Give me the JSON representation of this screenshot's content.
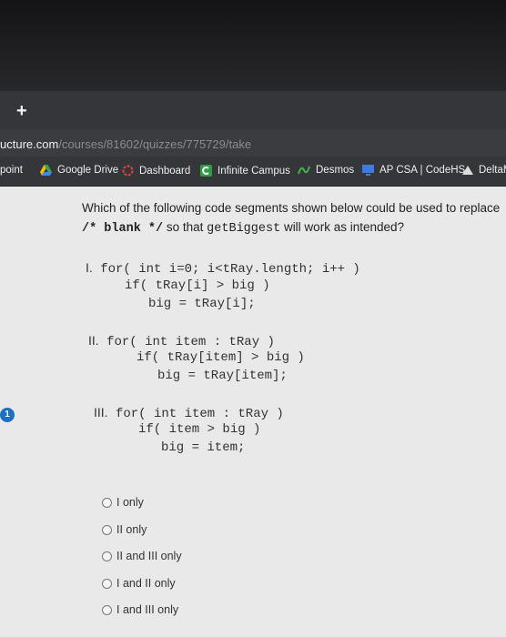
{
  "browser": {
    "url_host": "ucture.com",
    "url_path": "/courses/81602/quizzes/775729/take",
    "new_tab": "+"
  },
  "bookmarks": [
    {
      "label": "point"
    },
    {
      "label": "Google Drive"
    },
    {
      "label": "Dashboard"
    },
    {
      "label": "Infinite Campus"
    },
    {
      "label": "Desmos"
    },
    {
      "label": "AP CSA | CodeHS"
    },
    {
      "label": "DeltaM"
    }
  ],
  "quiz": {
    "badge": "1",
    "question_line1": "Which of the following code segments shown below could be used to replace",
    "question_code": "/* blank */",
    "question_tail_pre": "so that ",
    "question_method": "getBiggest",
    "question_tail_post": " will work as intended?",
    "segments": [
      {
        "numeral": "I.",
        "lines": [
          "for( int i=0; i<tRay.length; i++ )",
          "if( tRay[i] > big )",
          "big = tRay[i];"
        ]
      },
      {
        "numeral": "II.",
        "lines": [
          "for( int item : tRay )",
          "if( tRay[item] > big )",
          "big = tRay[item];"
        ]
      },
      {
        "numeral": "III.",
        "lines": [
          "for( int item : tRay )",
          "if( item > big )",
          "big = item;"
        ]
      }
    ],
    "options": [
      "I only",
      "II only",
      "II and III only",
      "I and II only",
      "I and III only"
    ]
  },
  "colors": {
    "badge": "#1d6fbf",
    "content_bg": "#e9e9e9",
    "toolbar": "#35363a"
  }
}
